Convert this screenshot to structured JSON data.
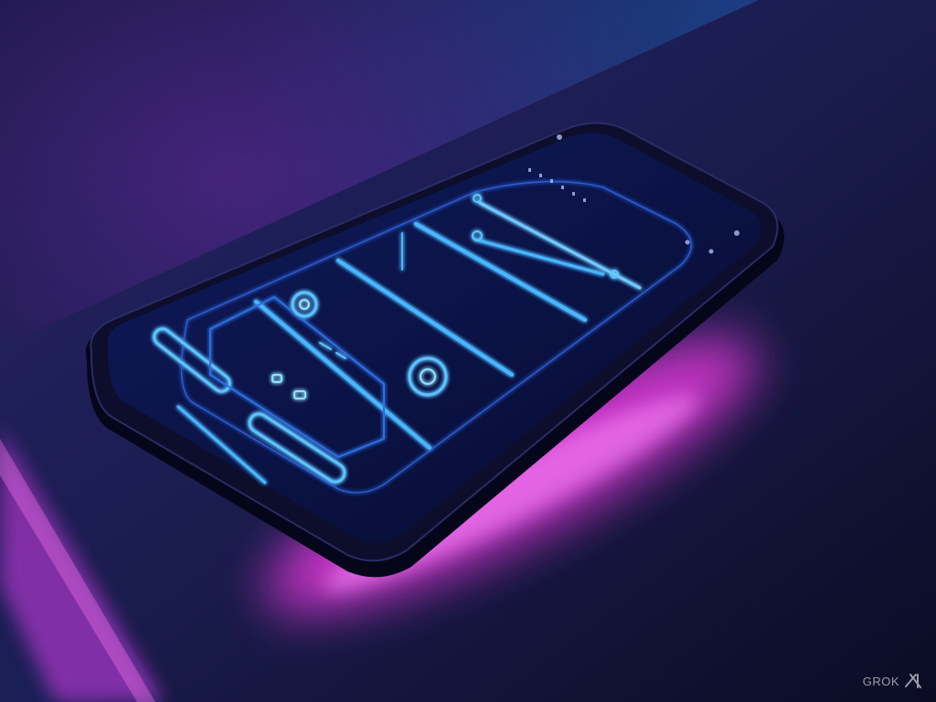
{
  "scene": {
    "subject": "smartphone-on-table",
    "screen_content": "neon-outline-wireframe",
    "colors": {
      "background_top": "#1b1d52",
      "background_bottom": "#0a0b22",
      "table_surface": "#1a1c4a",
      "underglow": "#e040ff",
      "neon_blue": "#3fa8ff",
      "neon_cyan": "#8fe3ff",
      "phone_body": "#0d0e2b"
    }
  },
  "watermark": {
    "text": "GROK"
  }
}
